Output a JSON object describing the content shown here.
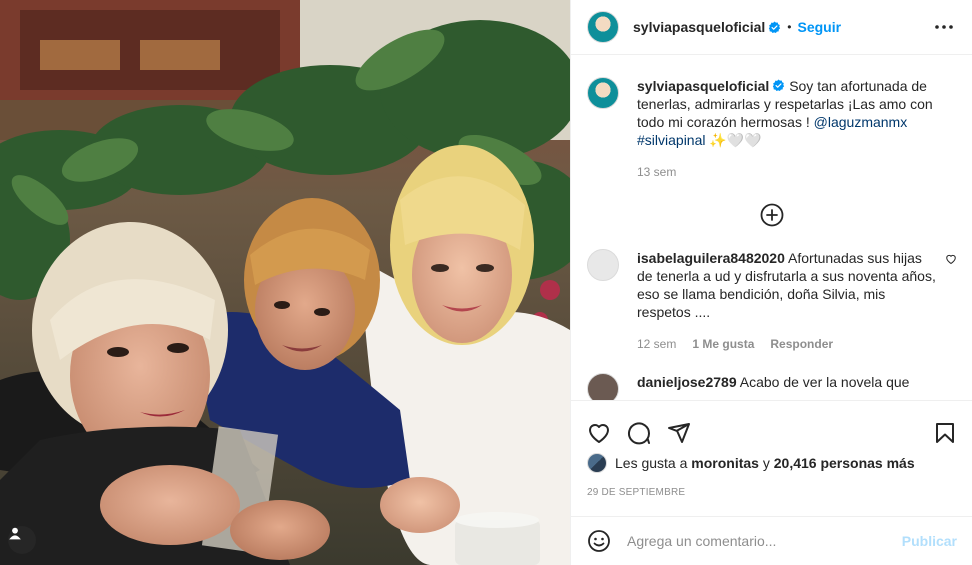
{
  "post": {
    "username": "sylviapasqueloficial",
    "separator": "•",
    "follow_label": "Seguir",
    "caption_text": "Soy tan afortunada de tenerlas, admirarlas y respetarlas ¡Las amo con todo mi corazón hermosas ! ",
    "mention": "@laguzmanmx",
    "hashtag": "#silviapinal",
    "caption_emojis": "✨🤍🤍",
    "caption_time": "13 sem"
  },
  "comments": [
    {
      "username": "isabelaguilera8482020",
      "text": "Afortunadas sus hijas de tenerla a ud y disfrutarla a sus noventa años, eso se llama bendición, doña Silvia, mis respetos ....",
      "time": "12 sem",
      "likes": "1 Me gusta",
      "reply_label": "Responder"
    },
    {
      "username": "danieljose2789",
      "text": "Acabo de ver la novela que"
    }
  ],
  "likes_line": {
    "prefix": "Les gusta a ",
    "user": "moronitas",
    "middle": " y ",
    "count": "20,416 personas más"
  },
  "post_date": "29 DE SEPTIEMBRE",
  "comment_box": {
    "placeholder": "Agrega un comentario...",
    "publish_label": "Publicar"
  },
  "colors": {
    "accent": "#0095f6",
    "link": "#00376b",
    "muted": "#8e8e8e",
    "publish_disabled": "#b2dffc"
  },
  "icons": [
    "heart-icon",
    "comment-icon",
    "share-icon",
    "bookmark-icon",
    "emoji-icon",
    "more-icon",
    "add-comment-icon",
    "verified-icon",
    "user-tag-icon"
  ]
}
